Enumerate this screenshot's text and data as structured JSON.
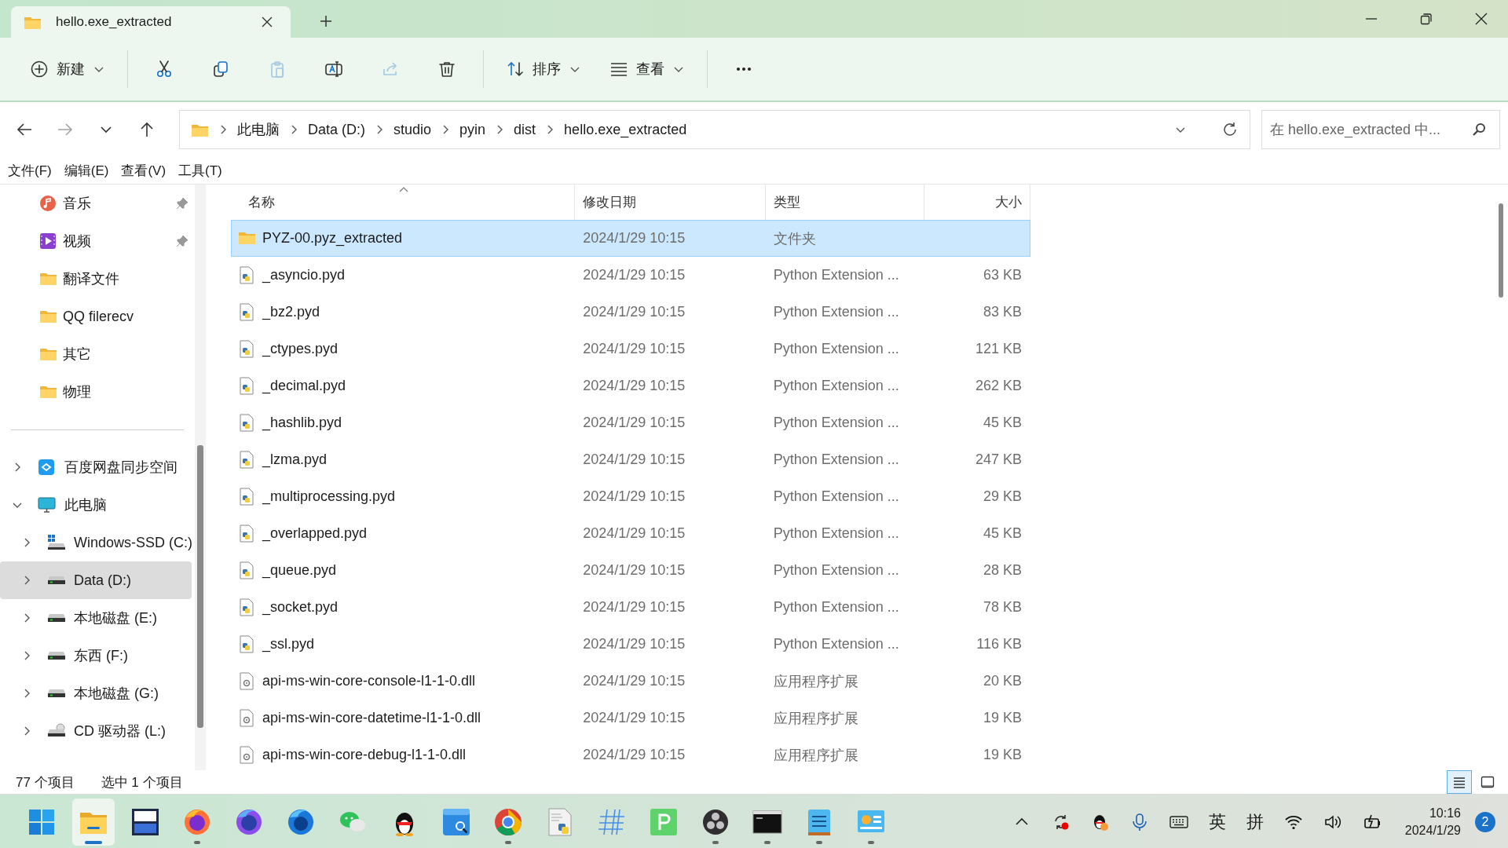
{
  "window": {
    "tabs": [
      {
        "title": "hello.exe_extracted",
        "selected": true
      }
    ]
  },
  "toolbar": {
    "items": [
      {
        "kind": "new",
        "label": "新建",
        "disabled": false
      },
      {
        "kind": "cut",
        "disabled": false
      },
      {
        "kind": "copy",
        "disabled": false
      },
      {
        "kind": "paste",
        "disabled": true
      },
      {
        "kind": "rename",
        "disabled": false
      },
      {
        "kind": "share",
        "disabled": true
      },
      {
        "kind": "delete",
        "disabled": false
      },
      {
        "kind": "sort",
        "label": "排序",
        "disabled": false
      },
      {
        "kind": "view",
        "label": "查看",
        "disabled": false
      },
      {
        "kind": "more",
        "disabled": false
      }
    ]
  },
  "navigation": {
    "back_disabled": false,
    "forward_disabled": true
  },
  "address_bar": {
    "segments": [
      "此电脑",
      "Data (D:)",
      "studio",
      "pyin",
      "dist",
      "hello.exe_extracted"
    ]
  },
  "search": {
    "placeholder": "在 hello.exe_extracted 中..."
  },
  "menu_bar": [
    "文件(F)",
    "编辑(E)",
    "查看(V)",
    "工具(T)"
  ],
  "sidebar": {
    "quick_access": [
      {
        "label": "音乐",
        "kind": "music",
        "pinned": true
      },
      {
        "label": "视频",
        "kind": "video",
        "pinned": true
      },
      {
        "label": "翻译文件",
        "kind": "folder",
        "pinned": false
      },
      {
        "label": "QQ filerecv",
        "kind": "folder",
        "pinned": false
      },
      {
        "label": "其它",
        "kind": "folder",
        "pinned": false
      },
      {
        "label": "物理",
        "kind": "folder",
        "pinned": false
      }
    ],
    "tree": [
      {
        "label": "百度网盘同步空间",
        "kind": "cloud",
        "expanded": false,
        "selected": false
      },
      {
        "label": "此电脑",
        "kind": "pc",
        "expanded": true,
        "selected": false,
        "children": [
          {
            "label": "Windows-SSD (C:)",
            "kind": "os-drive",
            "expanded": false,
            "selected": false
          },
          {
            "label": "Data (D:)",
            "kind": "drive",
            "expanded": false,
            "selected": true
          },
          {
            "label": "本地磁盘 (E:)",
            "kind": "drive",
            "expanded": false,
            "selected": false
          },
          {
            "label": "东西 (F:)",
            "kind": "drive",
            "expanded": false,
            "selected": false
          },
          {
            "label": "本地磁盘 (G:)",
            "kind": "drive",
            "expanded": false,
            "selected": false
          },
          {
            "label": "CD 驱动器 (L:)",
            "kind": "cd-drive",
            "expanded": false,
            "selected": false
          }
        ]
      }
    ]
  },
  "table": {
    "columns": [
      {
        "label": "名称",
        "sorted": true
      },
      {
        "label": "修改日期",
        "sorted": false
      },
      {
        "label": "类型",
        "sorted": false
      },
      {
        "label": "大小",
        "sorted": false
      }
    ],
    "rows": [
      {
        "kind": "folder",
        "name": "PYZ-00.pyz_extracted",
        "date": "2024/1/29 10:15",
        "type": "文件夹",
        "selected": true
      },
      {
        "kind": "pyd",
        "name": "_asyncio.pyd",
        "date": "2024/1/29 10:15",
        "type": "Python Extension ...",
        "size": "63 KB",
        "selected": false
      },
      {
        "kind": "pyd",
        "name": "_bz2.pyd",
        "date": "2024/1/29 10:15",
        "type": "Python Extension ...",
        "size": "83 KB",
        "selected": false
      },
      {
        "kind": "pyd",
        "name": "_ctypes.pyd",
        "date": "2024/1/29 10:15",
        "type": "Python Extension ...",
        "size": "121 KB",
        "selected": false
      },
      {
        "kind": "pyd",
        "name": "_decimal.pyd",
        "date": "2024/1/29 10:15",
        "type": "Python Extension ...",
        "size": "262 KB",
        "selected": false
      },
      {
        "kind": "pyd",
        "name": "_hashlib.pyd",
        "date": "2024/1/29 10:15",
        "type": "Python Extension ...",
        "size": "45 KB",
        "selected": false
      },
      {
        "kind": "pyd",
        "name": "_lzma.pyd",
        "date": "2024/1/29 10:15",
        "type": "Python Extension ...",
        "size": "247 KB",
        "selected": false
      },
      {
        "kind": "pyd",
        "name": "_multiprocessing.pyd",
        "date": "2024/1/29 10:15",
        "type": "Python Extension ...",
        "size": "29 KB",
        "selected": false
      },
      {
        "kind": "pyd",
        "name": "_overlapped.pyd",
        "date": "2024/1/29 10:15",
        "type": "Python Extension ...",
        "size": "45 KB",
        "selected": false
      },
      {
        "kind": "pyd",
        "name": "_queue.pyd",
        "date": "2024/1/29 10:15",
        "type": "Python Extension ...",
        "size": "28 KB",
        "selected": false
      },
      {
        "kind": "pyd",
        "name": "_socket.pyd",
        "date": "2024/1/29 10:15",
        "type": "Python Extension ...",
        "size": "78 KB",
        "selected": false
      },
      {
        "kind": "pyd",
        "name": "_ssl.pyd",
        "date": "2024/1/29 10:15",
        "type": "Python Extension ...",
        "size": "116 KB",
        "selected": false
      },
      {
        "kind": "dll",
        "name": "api-ms-win-core-console-l1-1-0.dll",
        "date": "2024/1/29 10:15",
        "type": "应用程序扩展",
        "size": "20 KB",
        "selected": false
      },
      {
        "kind": "dll",
        "name": "api-ms-win-core-datetime-l1-1-0.dll",
        "date": "2024/1/29 10:15",
        "type": "应用程序扩展",
        "size": "19 KB",
        "selected": false
      },
      {
        "kind": "dll",
        "name": "api-ms-win-core-debug-l1-1-0.dll",
        "date": "2024/1/29 10:15",
        "type": "应用程序扩展",
        "size": "19 KB",
        "selected": false
      }
    ]
  },
  "status_bar": {
    "item_count": "77 个项目",
    "selection": "选中 1 个项目",
    "views": [
      {
        "kind": "details",
        "selected": true
      },
      {
        "kind": "tiles",
        "selected": false
      }
    ]
  },
  "taskbar": {
    "apps": [
      {
        "kind": "start",
        "running": false,
        "active": false
      },
      {
        "kind": "explorer",
        "running": true,
        "active": true
      },
      {
        "kind": "ide",
        "running": false,
        "active": false
      },
      {
        "kind": "browser-orange",
        "running": true,
        "active": false
      },
      {
        "kind": "browser-purple",
        "running": false,
        "active": false
      },
      {
        "kind": "browser-blue",
        "running": false,
        "active": false
      },
      {
        "kind": "chat",
        "running": false,
        "active": false
      },
      {
        "kind": "penguin",
        "running": false,
        "active": false
      },
      {
        "kind": "dictionary",
        "running": false,
        "active": false
      },
      {
        "kind": "chrome",
        "running": true,
        "active": false
      },
      {
        "kind": "script",
        "running": false,
        "active": false
      },
      {
        "kind": "hash",
        "running": false,
        "active": false
      },
      {
        "kind": "green-p",
        "running": false,
        "active": false
      },
      {
        "kind": "recorder",
        "running": true,
        "active": false
      },
      {
        "kind": "terminal",
        "running": true,
        "active": false
      },
      {
        "kind": "notepad",
        "running": true,
        "active": false
      },
      {
        "kind": "board",
        "running": true,
        "active": false
      }
    ],
    "tray": [
      {
        "kind": "chevron"
      },
      {
        "kind": "sync"
      },
      {
        "kind": "penguin"
      },
      {
        "kind": "mic"
      },
      {
        "kind": "keyboard"
      },
      {
        "kind": "text",
        "text": "英"
      },
      {
        "kind": "text",
        "text": "拼"
      },
      {
        "kind": "wifi"
      },
      {
        "kind": "volume"
      },
      {
        "kind": "battery"
      }
    ],
    "clock": {
      "time": "10:16",
      "date": "2024/1/29"
    },
    "notifications": "2"
  }
}
